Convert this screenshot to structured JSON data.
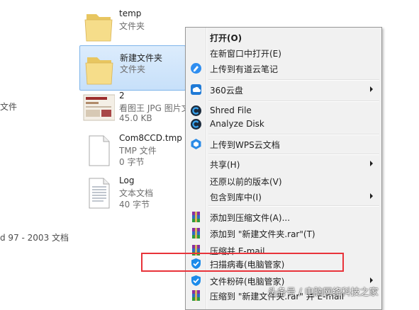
{
  "left_fragments": {
    "frag1": "文件",
    "frag2": "d 97 - 2003 文档"
  },
  "files": [
    {
      "name": "temp",
      "type": "文件夹",
      "icon": "folder-icon"
    },
    {
      "name": "新建文件夹",
      "type": "文件夹",
      "icon": "folder-icon",
      "selected": true
    },
    {
      "name": "2",
      "type": "看图王 JPG 图片文",
      "size": "45.0 KB",
      "icon": "image-thumbnail"
    },
    {
      "name": "Com8CCD.tmp",
      "type": "TMP 文件",
      "size": "0 字节",
      "icon": "blank-file-icon"
    },
    {
      "name": "Log",
      "type": "文本文档",
      "size": "40 字节",
      "icon": "text-file-icon"
    }
  ],
  "context_menu": {
    "items": {
      "open": {
        "label": "打开(O)"
      },
      "open_new_window": {
        "label": "在新窗口中打开(E)"
      },
      "youdao": {
        "label": "上传到有道云笔记",
        "icon": "youdao-note-icon"
      },
      "pan360": {
        "label": "360云盘",
        "icon": "360-cloud-icon"
      },
      "shred": {
        "label": "Shred File",
        "icon": "ccleaner-icon"
      },
      "analyze": {
        "label": "Analyze Disk",
        "icon": "ccleaner-icon"
      },
      "wps": {
        "label": "上传到WPS云文档",
        "icon": "wps-cloud-icon"
      },
      "share": {
        "label": "共享(H)"
      },
      "restore": {
        "label": "还原以前的版本(V)"
      },
      "library": {
        "label": "包含到库中(I)"
      },
      "add_archive": {
        "label": "添加到压缩文件(A)...",
        "icon": "winrar-icon"
      },
      "add_rar": {
        "label": "添加到 \"新建文件夹.rar\"(T)",
        "icon": "winrar-icon"
      },
      "email": {
        "label": "压缩并 E-mail...",
        "icon": "winrar-icon"
      },
      "scan": {
        "label": "扫描病毒(电脑管家)",
        "icon": "tencent-pc-manager-icon"
      },
      "shred_pcm": {
        "label": "文件粉碎(电脑管家)",
        "icon": "tencent-pc-manager-icon"
      },
      "compress_email": {
        "label": "压缩到 \"新建文件夹.rar\" 并 E-mail",
        "icon": "winrar-icon"
      }
    }
  },
  "watermark": "头条号 / 电脑网络科技之家",
  "colors": {
    "highlight": "#e8333a",
    "selection": "#cce4fb",
    "menu_bg": "#f1f1f1"
  }
}
